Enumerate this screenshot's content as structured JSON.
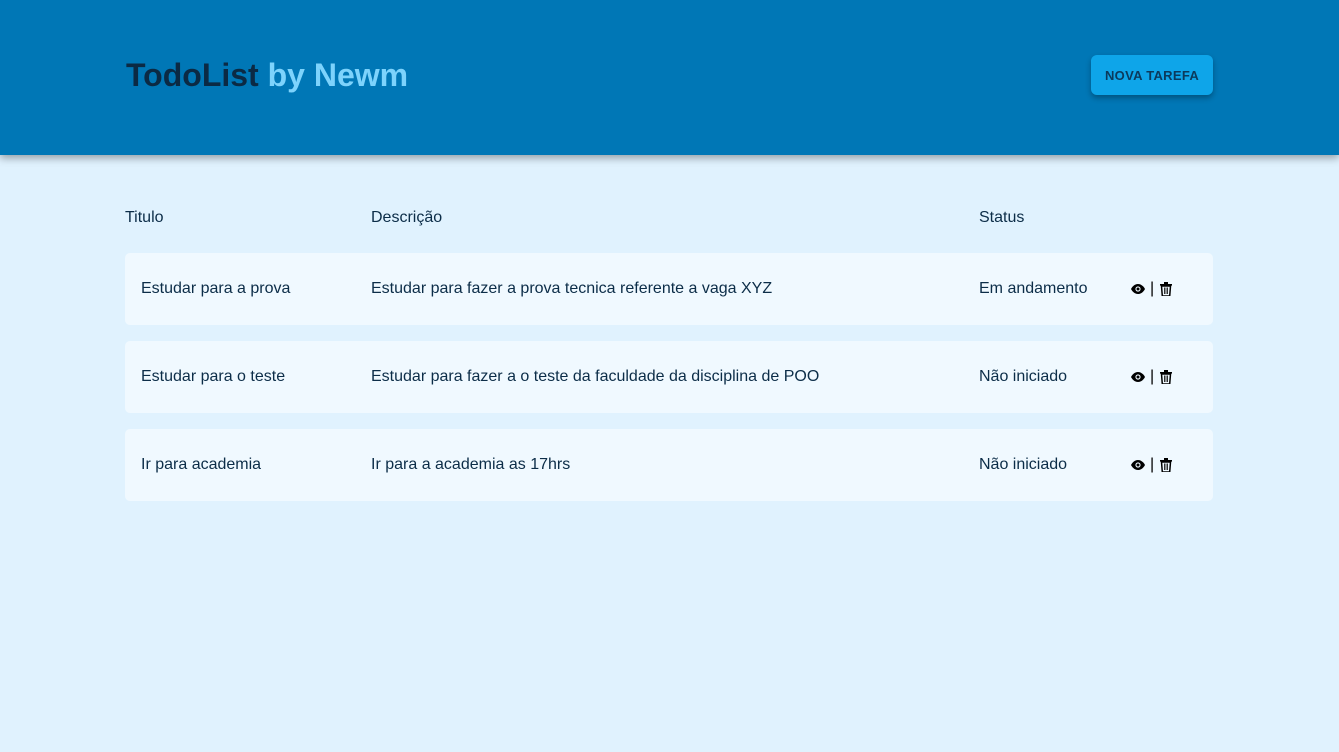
{
  "header": {
    "brand_name": "TodoList",
    "brand_suffix": "by Newm",
    "new_task_label": "NOVA TAREFA"
  },
  "table": {
    "columns": [
      "Titulo",
      "Descrição",
      "Status"
    ],
    "rows": [
      {
        "title": "Estudar para a prova",
        "description": "Estudar para fazer a prova tecnica referente a vaga XYZ",
        "status": "Em andamento"
      },
      {
        "title": "Estudar para o teste",
        "description": "Estudar para fazer a o teste da faculdade da disciplina de POO",
        "status": "Não iniciado"
      },
      {
        "title": "Ir para academia",
        "description": "Ir para a academia as 17hrs",
        "status": "Não iniciado"
      }
    ],
    "action_separator": "|",
    "action_icons": [
      "eye-icon",
      "trash-icon"
    ]
  },
  "colors": {
    "header_bg": "#0077b6",
    "page_bg": "#e0f2fe",
    "row_bg": "#f0f9ff",
    "button_bg": "#0ea5e9",
    "brand_accent": "#7dd3fc"
  }
}
